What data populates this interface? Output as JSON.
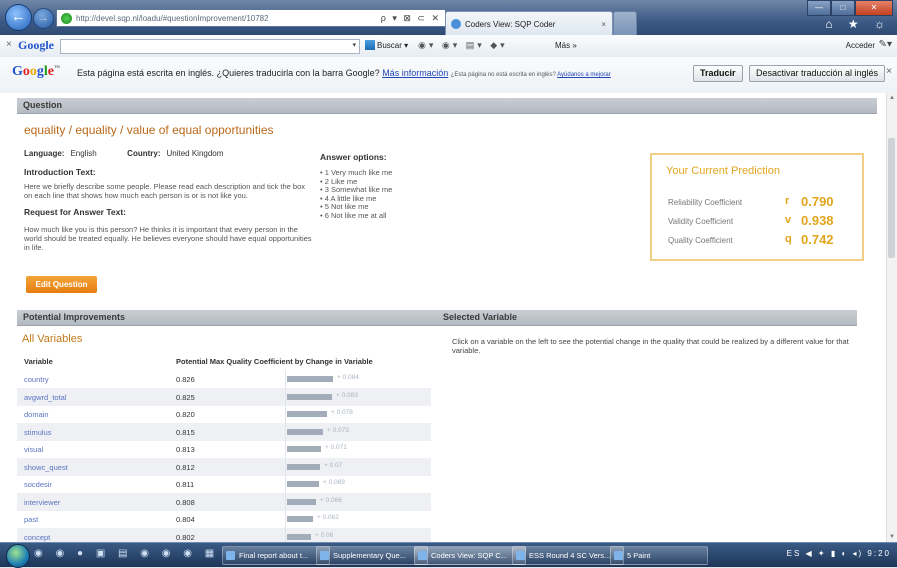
{
  "browser": {
    "url": "http://devel.sqp.nl/loadu/#questionImprovement/10782",
    "address_tools": "ρ ▾ ⊠ ⊂ ✕",
    "tab_title": "Coders View: SQP Coder",
    "tab_close": "×",
    "nav_back": "←",
    "nav_forward": "→",
    "win_min": "—",
    "win_max": "□",
    "win_close": "✕",
    "right_icons": "⌂ ★ ☼"
  },
  "google_toolbar": {
    "close": "×",
    "logo": "Google",
    "dropdown_arrow": "▾",
    "buscar_label": "Buscar ▾",
    "icons": "◉▾ ◉▾ ▤▾ ◆▾",
    "mas_label": "Más »",
    "acceder_label": "Acceder",
    "wrench": "✎▾"
  },
  "translate_bar": {
    "logo_parts": [
      "G",
      "o",
      "o",
      "g",
      "l",
      "e"
    ],
    "logo_tm": "™",
    "message": "Esta página está escrita en inglés. ¿Quieres traducirla con la barra Google?",
    "more_info": "Más información",
    "small_message": "¿Esta página no está escrita en inglés?",
    "help_link": "Ayúdanos a mejorar",
    "translate_button": "Traducir",
    "disable_button": "Desactivar traducción al inglés",
    "close": "×"
  },
  "question": {
    "header": "Question",
    "title": "equality / equality / value of equal opportunities",
    "language_label": "Language:",
    "language": "English",
    "country_label": "Country:",
    "country": "United Kingdom",
    "intro_label": "Introduction Text:",
    "intro_text": "Here we briefly describe some people. Please read each description and tick the box on each line that shows how much each person is or is not like you.",
    "request_label": "Request for Answer Text:",
    "request_text": "How much like you is this person? He thinks it is important that every person in the world should be treated equally. He believes everyone should have equal opportunities in life.",
    "answer_label": "Answer options:",
    "answer_options": [
      "1 Very much like me",
      "2 Like me",
      "3 Somewhat like me",
      "4 A little like me",
      "5 Not like me",
      "6 Not like me at all"
    ],
    "edit_button": "Edit Question"
  },
  "prediction": {
    "title": "Your Current Prediction",
    "rows": [
      {
        "label": "Reliability Coefficient",
        "symbol": "r",
        "value": "0.790"
      },
      {
        "label": "Validity Coefficient",
        "symbol": "v",
        "value": "0.938"
      },
      {
        "label": "Quality Coefficient",
        "symbol": "q",
        "value": "0.742"
      }
    ],
    "accent_color": "#e2a51c"
  },
  "improvements": {
    "header": "Potential Improvements",
    "subtitle": "All Variables",
    "col_variable": "Variable",
    "col_value": "Potential Max Quality Coefficient by Change in Variable",
    "rows": [
      {
        "name": "country",
        "value": "0.826",
        "delta": "+ 0.084",
        "bar": 0.084
      },
      {
        "name": "avgwrd_total",
        "value": "0.825",
        "delta": "+ 0.083",
        "bar": 0.083
      },
      {
        "name": "domain",
        "value": "0.820",
        "delta": "+ 0.078",
        "bar": 0.078
      },
      {
        "name": "stimulus",
        "value": "0.815",
        "delta": "+ 0.073",
        "bar": 0.073
      },
      {
        "name": "visual",
        "value": "0.813",
        "delta": "+ 0.071",
        "bar": 0.071
      },
      {
        "name": "showc_quest",
        "value": "0.812",
        "delta": "+ 0.07",
        "bar": 0.07
      },
      {
        "name": "socdesir",
        "value": "0.811",
        "delta": "+ 0.069",
        "bar": 0.069
      },
      {
        "name": "interviewer",
        "value": "0.808",
        "delta": "+ 0.066",
        "bar": 0.066
      },
      {
        "name": "past",
        "value": "0.804",
        "delta": "+ 0.062",
        "bar": 0.062
      },
      {
        "name": "concept",
        "value": "0.802",
        "delta": "+ 0.06",
        "bar": 0.06
      }
    ]
  },
  "selected_variable": {
    "header": "Selected Variable",
    "text": "Click on a variable on the left to see the potential change in the quality that could be realized by a different value for that variable."
  },
  "taskbar": {
    "quicklaunch": "◉ ◉ ● ▣ ▤ ◉ ◉ ◉ ▦",
    "buttons": [
      "Final report about t...",
      "Supplementary Que...",
      "Coders View: SQP C...",
      "ESS Round 4 SC Vers...",
      "5 Paint"
    ],
    "tray_lang": "ES",
    "clock": "9:20"
  }
}
